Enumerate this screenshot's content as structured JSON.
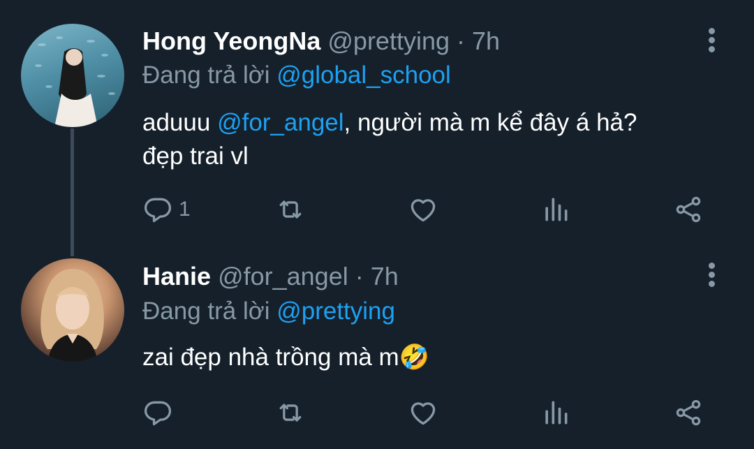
{
  "tweets": [
    {
      "name": "Hong YeongNa",
      "handle": "@prettying",
      "separator": "·",
      "time": "7h",
      "reply_prefix": "Đang trả lời",
      "reply_to": "@global_school",
      "text_before": "aduuu ",
      "text_mention": "@for_angel",
      "text_after": ", người mà m kể đây á hả?",
      "text_line2": "đẹp trai vl",
      "reply_count": "1",
      "icons": [
        "reply-icon",
        "retweet-icon",
        "like-icon",
        "stats-icon",
        "share-icon",
        "more-icon"
      ]
    },
    {
      "name": "Hanie",
      "handle": "@for_angel",
      "separator": "·",
      "time": "7h",
      "reply_prefix": "Đang trả lời",
      "reply_to": "@prettying",
      "text": "zai đẹp nhà trồng mà m🤣",
      "reply_count": "",
      "icons": [
        "reply-icon",
        "retweet-icon",
        "like-icon",
        "stats-icon",
        "share-icon",
        "more-icon"
      ]
    }
  ],
  "colors": {
    "background": "#15202b",
    "text": "#ffffff",
    "muted": "#8899a6",
    "link": "#1da1f2",
    "thread_line": "#3d4a57"
  }
}
